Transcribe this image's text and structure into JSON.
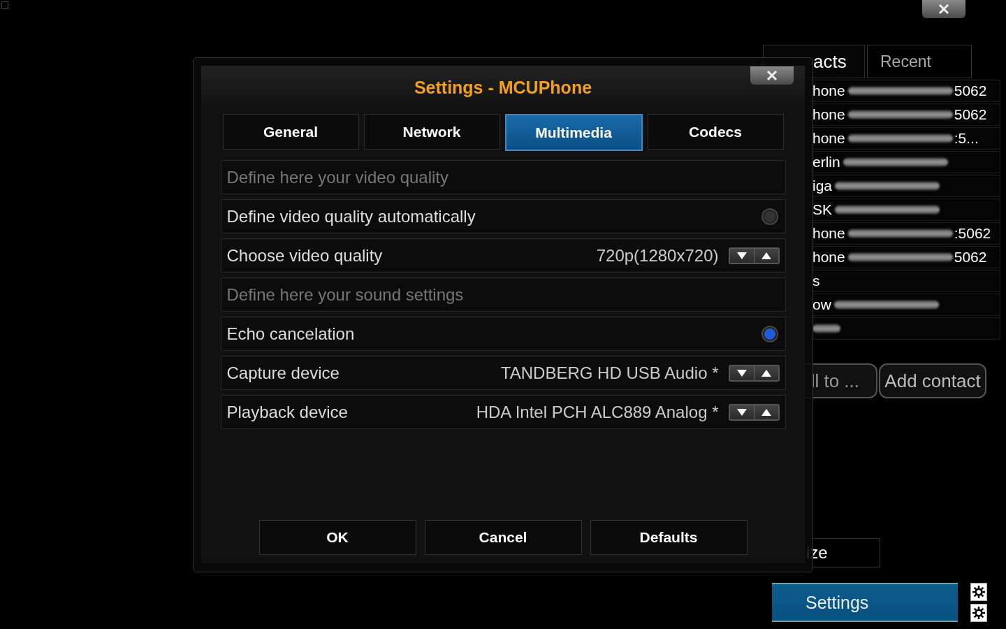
{
  "background_app": {
    "tabs": [
      {
        "label": "acts",
        "selected": true
      },
      {
        "label": "Recent",
        "selected": false
      }
    ],
    "contacts": [
      {
        "name": "hone",
        "address": "5062",
        "redacted": true
      },
      {
        "name": "hone",
        "address": "5062",
        "redacted": true
      },
      {
        "name": "hone",
        "address": ":5...",
        "redacted": true
      },
      {
        "name": "erlin",
        "redacted": true
      },
      {
        "name": "iga",
        "redacted": true
      },
      {
        "name": "SK",
        "redacted": true
      },
      {
        "name": "hone",
        "address": ":5062",
        "redacted": true
      },
      {
        "name": "hone",
        "address": "5062",
        "redacted": true
      },
      {
        "name": "s",
        "redacted": false
      },
      {
        "name": "ow",
        "redacted": true
      },
      {
        "redacted": true
      }
    ],
    "actions": [
      "ll to ...",
      "Add contact"
    ],
    "size_label": "ize",
    "settings_button": "Settings"
  },
  "dialog": {
    "title": "Settings - MCUPhone",
    "tabs": [
      {
        "label": "General",
        "selected": false
      },
      {
        "label": "Network",
        "selected": false
      },
      {
        "label": "Multimedia",
        "selected": true
      },
      {
        "label": "Codecs",
        "selected": false
      }
    ],
    "rows": [
      {
        "kind": "header",
        "label": "Define here your video quality"
      },
      {
        "kind": "radio",
        "label": "Define video quality automatically",
        "on": false
      },
      {
        "kind": "spinner",
        "label": "Choose video quality",
        "value": "720p(1280x720)"
      },
      {
        "kind": "header",
        "label": "Define here your sound settings"
      },
      {
        "kind": "radio",
        "label": "Echo cancelation",
        "on": true
      },
      {
        "kind": "spinner",
        "label": "Capture device",
        "value": "TANDBERG HD USB Audio *"
      },
      {
        "kind": "spinner",
        "label": "Playback device",
        "value": "HDA Intel PCH ALC889 Analog *"
      }
    ],
    "buttons": [
      "OK",
      "Cancel",
      "Defaults"
    ]
  }
}
